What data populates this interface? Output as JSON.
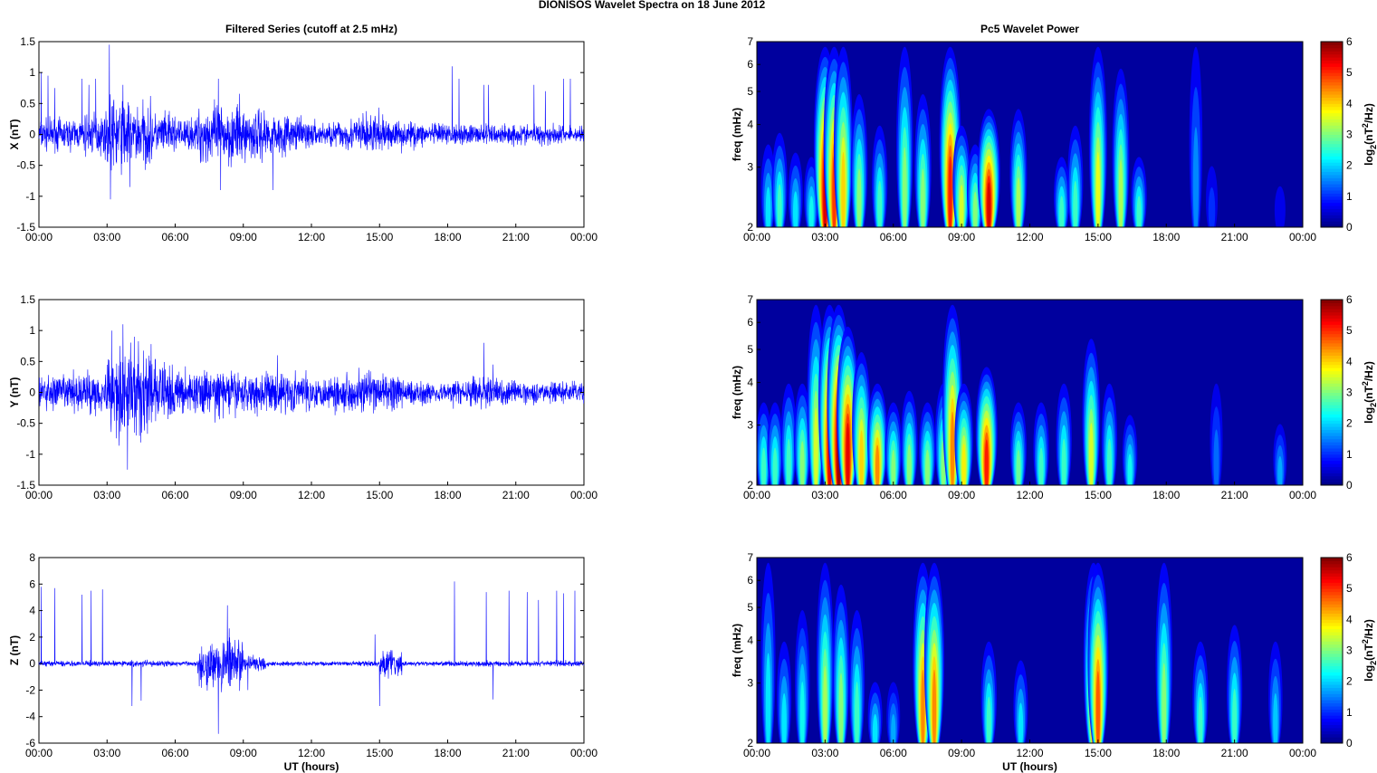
{
  "title": "DIONISOS Wavelet Spectra on 18 June      2012",
  "chart_data": [
    {
      "type": "line",
      "title": "Filtered Series (cutoff at 2.5 mHz)",
      "ylabel": "X (nT)",
      "xlabel": "",
      "ylim": [
        -1.5,
        1.5
      ],
      "xlim": [
        0,
        24
      ],
      "yticks": [
        "-1.5",
        "-1",
        "-0.5",
        "0",
        "0.5",
        "1",
        "1.5"
      ],
      "ytick_values": [
        -1.5,
        -1,
        -0.5,
        0,
        0.5,
        1,
        1.5
      ],
      "xticks": [
        "00:00",
        "03:00",
        "06:00",
        "09:00",
        "12:00",
        "15:00",
        "18:00",
        "21:00",
        "00:00"
      ],
      "noise_amplitude_by_hour": [
        0.15,
        0.15,
        0.2,
        0.35,
        0.3,
        0.2,
        0.15,
        0.28,
        0.3,
        0.25,
        0.2,
        0.15,
        0.12,
        0.15,
        0.2,
        0.15,
        0.12,
        0.1,
        0.1,
        0.1,
        0.1,
        0.1,
        0.1,
        0.08
      ],
      "spikes": [
        [
          0.1,
          1
        ],
        [
          0.4,
          0.95
        ],
        [
          0.7,
          0.75
        ],
        [
          1.9,
          0.9
        ],
        [
          2.2,
          0.8
        ],
        [
          2.5,
          0.9
        ],
        [
          3.1,
          1.45
        ],
        [
          3.15,
          -1.05
        ],
        [
          3.7,
          0.8
        ],
        [
          4.0,
          -0.85
        ],
        [
          7.9,
          0.9
        ],
        [
          8.0,
          -0.9
        ],
        [
          10.3,
          -0.9
        ],
        [
          18.2,
          1.1
        ],
        [
          18.5,
          0.9
        ],
        [
          19.6,
          0.8
        ],
        [
          19.8,
          0.8
        ],
        [
          21.8,
          0.8
        ],
        [
          22.3,
          0.7
        ],
        [
          23.1,
          0.9
        ],
        [
          23.4,
          0.9
        ]
      ]
    },
    {
      "type": "line",
      "title": "",
      "ylabel": "Y (nT)",
      "xlabel": "",
      "ylim": [
        -1.5,
        1.5
      ],
      "xlim": [
        0,
        24
      ],
      "yticks": [
        "-1.5",
        "-1",
        "-0.5",
        "0",
        "0.5",
        "1",
        "1.5"
      ],
      "ytick_values": [
        -1.5,
        -1,
        -0.5,
        0,
        0.5,
        1,
        1.5
      ],
      "xticks": [
        "00:00",
        "03:00",
        "06:00",
        "09:00",
        "12:00",
        "15:00",
        "18:00",
        "21:00",
        "00:00"
      ],
      "noise_amplitude_by_hour": [
        0.18,
        0.18,
        0.22,
        0.4,
        0.45,
        0.3,
        0.2,
        0.22,
        0.2,
        0.2,
        0.2,
        0.18,
        0.15,
        0.18,
        0.2,
        0.18,
        0.12,
        0.1,
        0.12,
        0.14,
        0.12,
        0.1,
        0.1,
        0.1
      ],
      "spikes": [
        [
          3.2,
          1.0
        ],
        [
          3.7,
          1.1
        ],
        [
          3.9,
          -1.25
        ],
        [
          4.2,
          0.9
        ],
        [
          10.5,
          0.6
        ],
        [
          19.6,
          0.8
        ],
        [
          20.0,
          0.45
        ]
      ]
    },
    {
      "type": "line",
      "title": "",
      "ylabel": "Z (nT)",
      "xlabel": "UT (hours)",
      "ylim": [
        -6,
        8
      ],
      "xlim": [
        0,
        24
      ],
      "yticks": [
        "-6",
        "-4",
        "-2",
        "0",
        "2",
        "4",
        "6",
        "8"
      ],
      "ytick_values": [
        -6,
        -4,
        -2,
        0,
        2,
        4,
        6,
        8
      ],
      "xticks": [
        "00:00",
        "03:00",
        "06:00",
        "09:00",
        "12:00",
        "15:00",
        "18:00",
        "21:00",
        "00:00"
      ],
      "noise_amplitude_by_hour": [
        0.12,
        0.12,
        0.12,
        0.12,
        0.15,
        0.12,
        0.12,
        1.0,
        1.2,
        0.4,
        0.12,
        0.1,
        0.1,
        0.1,
        0.12,
        0.6,
        0.1,
        0.1,
        0.12,
        0.12,
        0.12,
        0.12,
        0.14,
        0.12
      ],
      "spikes": [
        [
          0.1,
          5.8
        ],
        [
          0.7,
          5.7
        ],
        [
          1.9,
          5.2
        ],
        [
          2.3,
          5.5
        ],
        [
          2.8,
          5.6
        ],
        [
          4.1,
          -3.2
        ],
        [
          4.5,
          -2.8
        ],
        [
          7.9,
          -5.3
        ],
        [
          8.3,
          4.4
        ],
        [
          8.8,
          1.8
        ],
        [
          9.2,
          -2
        ],
        [
          14.8,
          2.2
        ],
        [
          15.0,
          -3.2
        ],
        [
          18.3,
          6.2
        ],
        [
          19.7,
          5.4
        ],
        [
          20.0,
          -2.7
        ],
        [
          20.7,
          5.5
        ],
        [
          21.5,
          5.4
        ],
        [
          22.0,
          4.8
        ],
        [
          22.8,
          5.5
        ],
        [
          23.1,
          5.3
        ],
        [
          23.6,
          5.5
        ]
      ]
    },
    {
      "type": "heatmap",
      "title": "Pc5 Wavelet Power",
      "ylabel": "freq (mHz)",
      "xlabel": "",
      "colorbar_label": "log2(nT2/Hz)",
      "clim": [
        0,
        6
      ],
      "ylim": [
        2,
        7
      ],
      "yscale": "log",
      "yticks": [
        "2",
        "3",
        "4",
        "5",
        "6",
        "7"
      ],
      "cbticks": [
        "0",
        "1",
        "2",
        "3",
        "4",
        "5",
        "6"
      ],
      "xticks": [
        "00:00",
        "03:00",
        "06:00",
        "09:00",
        "12:00",
        "15:00",
        "18:00",
        "21:00",
        "00:00"
      ],
      "blobs_time_hour_freqtop_power": [
        [
          0.5,
          3.5,
          2
        ],
        [
          1.0,
          3.8,
          2.5
        ],
        [
          1.7,
          3.3,
          2
        ],
        [
          2.4,
          3.2,
          2.2
        ],
        [
          3.0,
          7,
          5.6
        ],
        [
          3.4,
          7,
          5
        ],
        [
          3.8,
          7,
          4
        ],
        [
          4.5,
          5,
          3
        ],
        [
          5.4,
          4,
          2.5
        ],
        [
          6.5,
          7,
          3
        ],
        [
          7.3,
          5,
          3
        ],
        [
          8.5,
          7,
          5.2
        ],
        [
          9.0,
          4,
          3.5
        ],
        [
          9.6,
          3.5,
          3
        ],
        [
          10.2,
          4.5,
          5.6
        ],
        [
          11.5,
          4.5,
          3.2
        ],
        [
          13.4,
          3.2,
          2.5
        ],
        [
          14.0,
          4,
          2.5
        ],
        [
          15.0,
          7,
          3.6
        ],
        [
          16.0,
          6,
          3.2
        ],
        [
          16.8,
          3.2,
          2.5
        ],
        [
          19.3,
          7,
          1.4
        ],
        [
          20.0,
          3,
          0.8
        ],
        [
          23.0,
          2.6,
          0.4
        ]
      ]
    },
    {
      "type": "heatmap",
      "title": "",
      "ylabel": "freq (mHz)",
      "xlabel": "",
      "colorbar_label": "log2(nT2/Hz)",
      "clim": [
        0,
        6
      ],
      "ylim": [
        2,
        7
      ],
      "yscale": "log",
      "yticks": [
        "2",
        "3",
        "4",
        "5",
        "6",
        "7"
      ],
      "cbticks": [
        "0",
        "1",
        "2",
        "3",
        "4",
        "5",
        "6"
      ],
      "xticks": [
        "00:00",
        "03:00",
        "06:00",
        "09:00",
        "12:00",
        "15:00",
        "18:00",
        "21:00",
        "00:00"
      ],
      "blobs_time_hour_freqtop_power": [
        [
          0.3,
          3.5,
          2.5
        ],
        [
          0.8,
          3.5,
          2.5
        ],
        [
          1.4,
          4,
          2.5
        ],
        [
          2.0,
          4,
          3
        ],
        [
          2.6,
          7,
          3.5
        ],
        [
          3.2,
          7,
          5.5
        ],
        [
          3.6,
          7,
          6
        ],
        [
          4.0,
          6,
          5.5
        ],
        [
          4.6,
          5,
          4
        ],
        [
          5.3,
          4,
          4.5
        ],
        [
          6.0,
          3.5,
          3
        ],
        [
          6.7,
          3.8,
          3
        ],
        [
          7.5,
          3.5,
          3
        ],
        [
          8.2,
          4,
          3
        ],
        [
          8.6,
          7,
          4.5
        ],
        [
          9.1,
          4,
          3.8
        ],
        [
          10.1,
          4.5,
          5.2
        ],
        [
          11.5,
          3.5,
          2.8
        ],
        [
          12.5,
          3.5,
          2.5
        ],
        [
          13.5,
          4,
          2.5
        ],
        [
          14.7,
          5.5,
          3.5
        ],
        [
          15.5,
          4,
          2.5
        ],
        [
          16.4,
          3.2,
          2.2
        ],
        [
          20.2,
          4,
          1.2
        ],
        [
          23.0,
          3,
          1.6
        ]
      ]
    },
    {
      "type": "heatmap",
      "title": "",
      "ylabel": "freq (mHz)",
      "xlabel": "UT (hours)",
      "colorbar_label": "log2(nT2/Hz)",
      "clim": [
        0,
        6
      ],
      "ylim": [
        2,
        7
      ],
      "yscale": "log",
      "yticks": [
        "2",
        "3",
        "4",
        "5",
        "6",
        "7"
      ],
      "cbticks": [
        "0",
        "1",
        "2",
        "3",
        "4",
        "5",
        "6"
      ],
      "xticks": [
        "00:00",
        "03:00",
        "06:00",
        "09:00",
        "12:00",
        "15:00",
        "18:00",
        "21:00",
        "00:00"
      ],
      "blobs_time_hour_freqtop_power": [
        [
          0.5,
          7,
          2
        ],
        [
          1.2,
          4,
          2
        ],
        [
          2.0,
          5,
          2.2
        ],
        [
          3.0,
          7,
          3.2
        ],
        [
          3.7,
          6,
          3
        ],
        [
          4.4,
          5,
          2.5
        ],
        [
          5.2,
          3,
          2
        ],
        [
          6.0,
          3,
          1.6
        ],
        [
          7.3,
          7,
          4.5
        ],
        [
          7.8,
          7,
          4.5
        ],
        [
          10.2,
          4,
          2.5
        ],
        [
          11.6,
          3.5,
          2
        ],
        [
          14.8,
          7,
          4.5
        ],
        [
          15.0,
          7,
          4.8
        ],
        [
          17.9,
          7,
          3
        ],
        [
          19.5,
          4,
          2.5
        ],
        [
          21.0,
          4.5,
          2.5
        ],
        [
          22.8,
          4,
          1.8
        ]
      ]
    }
  ]
}
